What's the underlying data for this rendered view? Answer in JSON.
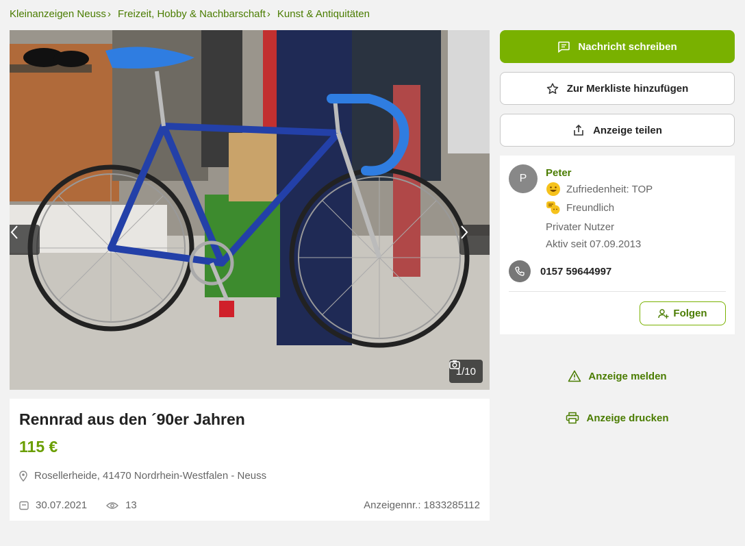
{
  "breadcrumb": [
    "Kleinanzeigen Neuss",
    "Freizeit, Hobby & Nachbarschaft",
    "Kunst & Antiquitäten"
  ],
  "gallery": {
    "counter": "1/10"
  },
  "ad": {
    "title": "Rennrad aus den ´90er Jahren",
    "price": "115 €",
    "location": "Rosellerheide, 41470 Nordrhein-Westfalen - Neuss",
    "date": "30.07.2021",
    "views": "13",
    "ad_number": "Anzeigennr.: 1833285112"
  },
  "actions": {
    "message": "Nachricht schreiben",
    "watchlist": "Zur Merkliste hinzufügen",
    "share": "Anzeige teilen",
    "report": "Anzeige melden",
    "print": "Anzeige drucken"
  },
  "seller": {
    "initial": "P",
    "name": "Peter",
    "satisfaction": "Zufriedenheit: TOP",
    "friendliness": "Freundlich",
    "type": "Privater Nutzer",
    "active_since": "Aktiv seit 07.09.2013",
    "phone": "0157 59644997",
    "follow": "Folgen"
  },
  "colors": {
    "accent": "#79b100",
    "accent_text": "#4a7c00",
    "price": "#6a9e00"
  }
}
